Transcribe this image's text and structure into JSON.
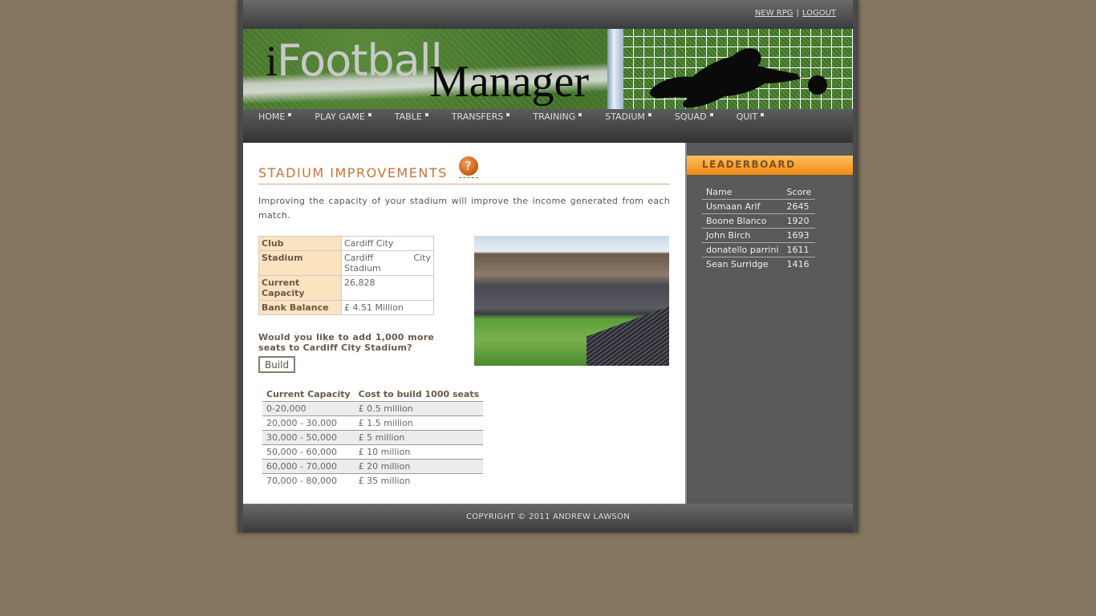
{
  "header": {
    "links": [
      {
        "label": "NEW RPG"
      },
      {
        "label": "LOGOUT"
      }
    ],
    "separator": "|",
    "logo": {
      "part1_i": "i",
      "part1": "Football",
      "part2": "Manager"
    }
  },
  "nav": {
    "items": [
      {
        "label": "HOME"
      },
      {
        "label": "PLAY GAME"
      },
      {
        "label": "TABLE"
      },
      {
        "label": "TRANSFERS"
      },
      {
        "label": "TRAINING"
      },
      {
        "label": "STADIUM"
      },
      {
        "label": "SQUAD"
      },
      {
        "label": "QUIT"
      }
    ]
  },
  "main": {
    "title": "STADIUM IMPROVEMENTS",
    "help_icon": "?",
    "intro": "Improving the capacity of your stadium will improve the income generated from each match.",
    "info": [
      {
        "key": "Club",
        "value": "Cardiff City"
      },
      {
        "key": "Stadium",
        "value": "Cardiff City Stadium"
      },
      {
        "key": "Current Capacity",
        "value": "26,828"
      },
      {
        "key": "Bank Balance",
        "value": "£ 4.51 Million"
      }
    ],
    "question": "Would you like to add 1,000 more seats to Cardiff City Stadium?",
    "build_label": "Build",
    "costs": {
      "headers": [
        "Current Capacity",
        "Cost to build 1000 seats"
      ],
      "rows": [
        [
          "0-20,000",
          "£ 0.5 million"
        ],
        [
          "20,000 - 30,000",
          "£ 1.5 million"
        ],
        [
          "30,000 - 50,000",
          "£ 5 million"
        ],
        [
          "50,000 - 60,000",
          "£ 10 million"
        ],
        [
          "60,000 - 70,000",
          "£ 20 million"
        ],
        [
          "70,000 - 80,000",
          "£ 35 million"
        ]
      ]
    }
  },
  "sidebar": {
    "title": "LEADERBOARD",
    "headers": [
      "Name",
      "Score"
    ],
    "rows": [
      [
        "Usmaan Arif",
        "2645"
      ],
      [
        "Boone Blanco",
        "1920"
      ],
      [
        "John Birch",
        "1693"
      ],
      [
        "donatello parrini",
        "1611"
      ],
      [
        "Sean Surridge",
        "1416"
      ]
    ]
  },
  "footer": {
    "text": "COPYRIGHT © 2011 ANDREW LAWSON"
  },
  "colors": {
    "accent": "#c4753a",
    "leaderboard_header": "#f5a030",
    "background": "#857660"
  }
}
